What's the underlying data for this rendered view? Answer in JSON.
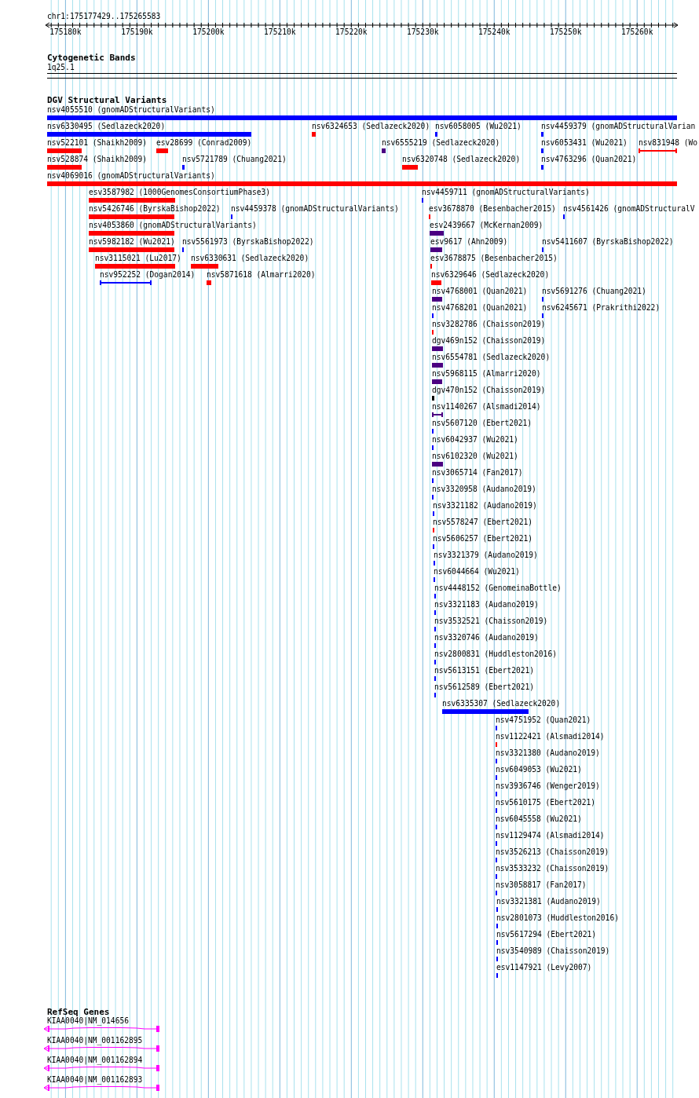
{
  "ruler": {
    "locus": "chr1:175177429..175265583",
    "ticks": [
      "175180k",
      "175190k",
      "175200k",
      "175210k",
      "175220k",
      "175230k",
      "175240k",
      "175250k",
      "175260k"
    ]
  },
  "cytogenetic_bands": {
    "title": "Cytogenetic Bands",
    "band": "1q25.1"
  },
  "dgv_structural_variants": {
    "title": "DGV Structural Variants",
    "features": [
      {
        "label": "nsv4055510 (gnomADStructuralVariants)",
        "color": "#0000ff",
        "kind": "bar"
      },
      {
        "label": "nsv6330495 (Sedlazeck2020)",
        "color": "#0000ff",
        "kind": "bar"
      },
      {
        "label": "nsv6324653 (Sedlazeck2020)",
        "color": "#ff0000",
        "kind": "bar"
      },
      {
        "label": "nsv6058005 (Wu2021)",
        "color": "#0000ff",
        "kind": "bar"
      },
      {
        "label": "nsv4459379 (gnomADStructuralVarian",
        "color": "#0000ff",
        "kind": "bar"
      },
      {
        "label": "nsv522101 (Shaikh2009)",
        "color": "#ff0000",
        "kind": "bar"
      },
      {
        "label": "esv28699 (Conrad2009)",
        "color": "#ff0000",
        "kind": "bar"
      },
      {
        "label": "nsv6555219 (Sedlazeck2020)",
        "color": "#4b0082",
        "kind": "bar"
      },
      {
        "label": "nsv6053431 (Wu2021)",
        "color": "#0000ff",
        "kind": "bar"
      },
      {
        "label": "nsv831948 (Wo",
        "color": "#ff0000",
        "kind": "span"
      },
      {
        "label": "nsv528874 (Shaikh2009)",
        "color": "#ff0000",
        "kind": "bar"
      },
      {
        "label": "nsv5721789 (Chuang2021)",
        "color": "#0000ff",
        "kind": "bar"
      },
      {
        "label": "nsv6320748 (Sedlazeck2020)",
        "color": "#ff0000",
        "kind": "bar"
      },
      {
        "label": "nsv4763296 (Quan2021)",
        "color": "#0000ff",
        "kind": "bar"
      },
      {
        "label": "nsv4069016 (gnomADStructuralVariants)",
        "color": "#ff0000",
        "kind": "bar"
      },
      {
        "label": "esv3587982 (1000GenomesConsortiumPhase3)",
        "color": "#ff0000",
        "kind": "bar"
      },
      {
        "label": "nsv4459711 (gnomADStructuralVariants)",
        "color": "#0000ff",
        "kind": "bar"
      },
      {
        "label": "nsv5426746 (ByrskaBishop2022)",
        "color": "#ff0000",
        "kind": "bar"
      },
      {
        "label": "nsv4459378 (gnomADStructuralVariants)",
        "color": "#0000ff",
        "kind": "bar"
      },
      {
        "label": "esv3678870 (Besenbacher2015)",
        "color": "#ff0000",
        "kind": "bar"
      },
      {
        "label": "nsv4561426 (gnomADStructuralV",
        "color": "#0000ff",
        "kind": "bar"
      },
      {
        "label": "nsv4053860 (gnomADStructuralVariants)",
        "color": "#ff0000",
        "kind": "bar"
      },
      {
        "label": "esv2439667 (McKernan2009)",
        "color": "#4b0082",
        "kind": "bar"
      },
      {
        "label": "nsv5982182 (Wu2021)",
        "color": "#ff0000",
        "kind": "bar"
      },
      {
        "label": "nsv5561973 (ByrskaBishop2022)",
        "color": "#0000ff",
        "kind": "bar"
      },
      {
        "label": "esv9617 (Ahn2009)",
        "color": "#4b0082",
        "kind": "bar"
      },
      {
        "label": "nsv5411607 (ByrskaBishop2022)",
        "color": "#0000ff",
        "kind": "bar"
      },
      {
        "label": "nsv3115021 (Lu2017)",
        "color": "#ff0000",
        "kind": "bar"
      },
      {
        "label": "nsv6330631 (Sedlazeck2020)",
        "color": "#ff0000",
        "kind": "bar"
      },
      {
        "label": "esv3678875 (Besenbacher2015)",
        "color": "#ff0000",
        "kind": "bar"
      },
      {
        "label": "nsv952252 (Dogan2014)",
        "color": "#0000ff",
        "kind": "span"
      },
      {
        "label": "nsv5871618 (Almarri2020)",
        "color": "#ff0000",
        "kind": "bar"
      },
      {
        "label": "nsv6329646 (Sedlazeck2020)",
        "color": "#ff0000",
        "kind": "bar"
      },
      {
        "label": "nsv4768001 (Quan2021)",
        "color": "#4b0082",
        "kind": "bar"
      },
      {
        "label": "nsv5691276 (Chuang2021)",
        "color": "#0000ff",
        "kind": "bar"
      },
      {
        "label": "nsv4768201 (Quan2021)",
        "color": "#0000ff",
        "kind": "bar"
      },
      {
        "label": "nsv6245671 (Prakrithi2022)",
        "color": "#0000ff",
        "kind": "bar"
      },
      {
        "label": "nsv3282786 (Chaisson2019)",
        "color": "#ff0000",
        "kind": "bar"
      },
      {
        "label": "dgv469n152 (Chaisson2019)",
        "color": "#4b0082",
        "kind": "bar"
      },
      {
        "label": "nsv6554781 (Sedlazeck2020)",
        "color": "#4b0082",
        "kind": "bar"
      },
      {
        "label": "nsv5968115 (Almarri2020)",
        "color": "#4b0082",
        "kind": "bar"
      },
      {
        "label": "dgv470n152 (Chaisson2019)",
        "color": "#000000",
        "kind": "bar"
      },
      {
        "label": "nsv1140267 (Alsmadi2014)",
        "color": "#4b0082",
        "kind": "span"
      },
      {
        "label": "nsv5607120 (Ebert2021)",
        "color": "#0000ff",
        "kind": "bar"
      },
      {
        "label": "nsv6042937 (Wu2021)",
        "color": "#0000ff",
        "kind": "bar"
      },
      {
        "label": "nsv6102320 (Wu2021)",
        "color": "#4b0082",
        "kind": "bar"
      },
      {
        "label": "nsv3065714 (Fan2017)",
        "color": "#0000ff",
        "kind": "bar"
      },
      {
        "label": "nsv3320958 (Audano2019)",
        "color": "#0000ff",
        "kind": "bar"
      },
      {
        "label": "nsv3321182 (Audano2019)",
        "color": "#0000ff",
        "kind": "bar"
      },
      {
        "label": "nsv5578247 (Ebert2021)",
        "color": "#ff0000",
        "kind": "bar"
      },
      {
        "label": "nsv5606257 (Ebert2021)",
        "color": "#0000ff",
        "kind": "bar"
      },
      {
        "label": "nsv3321379 (Audano2019)",
        "color": "#0000ff",
        "kind": "bar"
      },
      {
        "label": "nsv6044664 (Wu2021)",
        "color": "#0000ff",
        "kind": "bar"
      },
      {
        "label": "nsv4448152 (GenomeinaBottle)",
        "color": "#0000ff",
        "kind": "bar"
      },
      {
        "label": "nsv3321183 (Audano2019)",
        "color": "#0000ff",
        "kind": "bar"
      },
      {
        "label": "nsv3532521 (Chaisson2019)",
        "color": "#0000ff",
        "kind": "bar"
      },
      {
        "label": "nsv3320746 (Audano2019)",
        "color": "#0000ff",
        "kind": "bar"
      },
      {
        "label": "nsv2800831 (Huddleston2016)",
        "color": "#0000ff",
        "kind": "bar"
      },
      {
        "label": "nsv5613151 (Ebert2021)",
        "color": "#0000ff",
        "kind": "bar"
      },
      {
        "label": "nsv5612589 (Ebert2021)",
        "color": "#0000ff",
        "kind": "bar"
      },
      {
        "label": "nsv6335307 (Sedlazeck2020)",
        "color": "#0000ff",
        "kind": "bar"
      },
      {
        "label": "nsv4751952 (Quan2021)",
        "color": "#0000ff",
        "kind": "bar"
      },
      {
        "label": "nsv1122421 (Alsmadi2014)",
        "color": "#ff0000",
        "kind": "bar"
      },
      {
        "label": "nsv3321380 (Audano2019)",
        "color": "#0000ff",
        "kind": "bar"
      },
      {
        "label": "nsv6049053 (Wu2021)",
        "color": "#0000ff",
        "kind": "bar"
      },
      {
        "label": "nsv3936746 (Wenger2019)",
        "color": "#0000ff",
        "kind": "bar"
      },
      {
        "label": "nsv5610175 (Ebert2021)",
        "color": "#0000ff",
        "kind": "bar"
      },
      {
        "label": "nsv6045558 (Wu2021)",
        "color": "#0000ff",
        "kind": "bar"
      },
      {
        "label": "nsv1129474 (Alsmadi2014)",
        "color": "#0000ff",
        "kind": "bar"
      },
      {
        "label": "nsv3526213 (Chaisson2019)",
        "color": "#0000ff",
        "kind": "bar"
      },
      {
        "label": "nsv3533232 (Chaisson2019)",
        "color": "#0000ff",
        "kind": "bar"
      },
      {
        "label": "nsv3058817 (Fan2017)",
        "color": "#0000ff",
        "kind": "bar"
      },
      {
        "label": "nsv3321381 (Audano2019)",
        "color": "#0000ff",
        "kind": "bar"
      },
      {
        "label": "nsv2801073 (Huddleston2016)",
        "color": "#0000ff",
        "kind": "bar"
      },
      {
        "label": "nsv5617294 (Ebert2021)",
        "color": "#0000ff",
        "kind": "bar"
      },
      {
        "label": "nsv3540989 (Chaisson2019)",
        "color": "#0000ff",
        "kind": "bar"
      },
      {
        "label": "esv1147921 (Levy2007)",
        "color": "#0000ff",
        "kind": "bar"
      }
    ]
  },
  "refseq_genes": {
    "title": "RefSeq Genes",
    "genes": [
      {
        "label": "KIAA0040|NM_014656"
      },
      {
        "label": "KIAA0040|NM_001162895"
      },
      {
        "label": "KIAA0040|NM_001162894"
      },
      {
        "label": "KIAA0040|NM_001162893"
      }
    ]
  }
}
